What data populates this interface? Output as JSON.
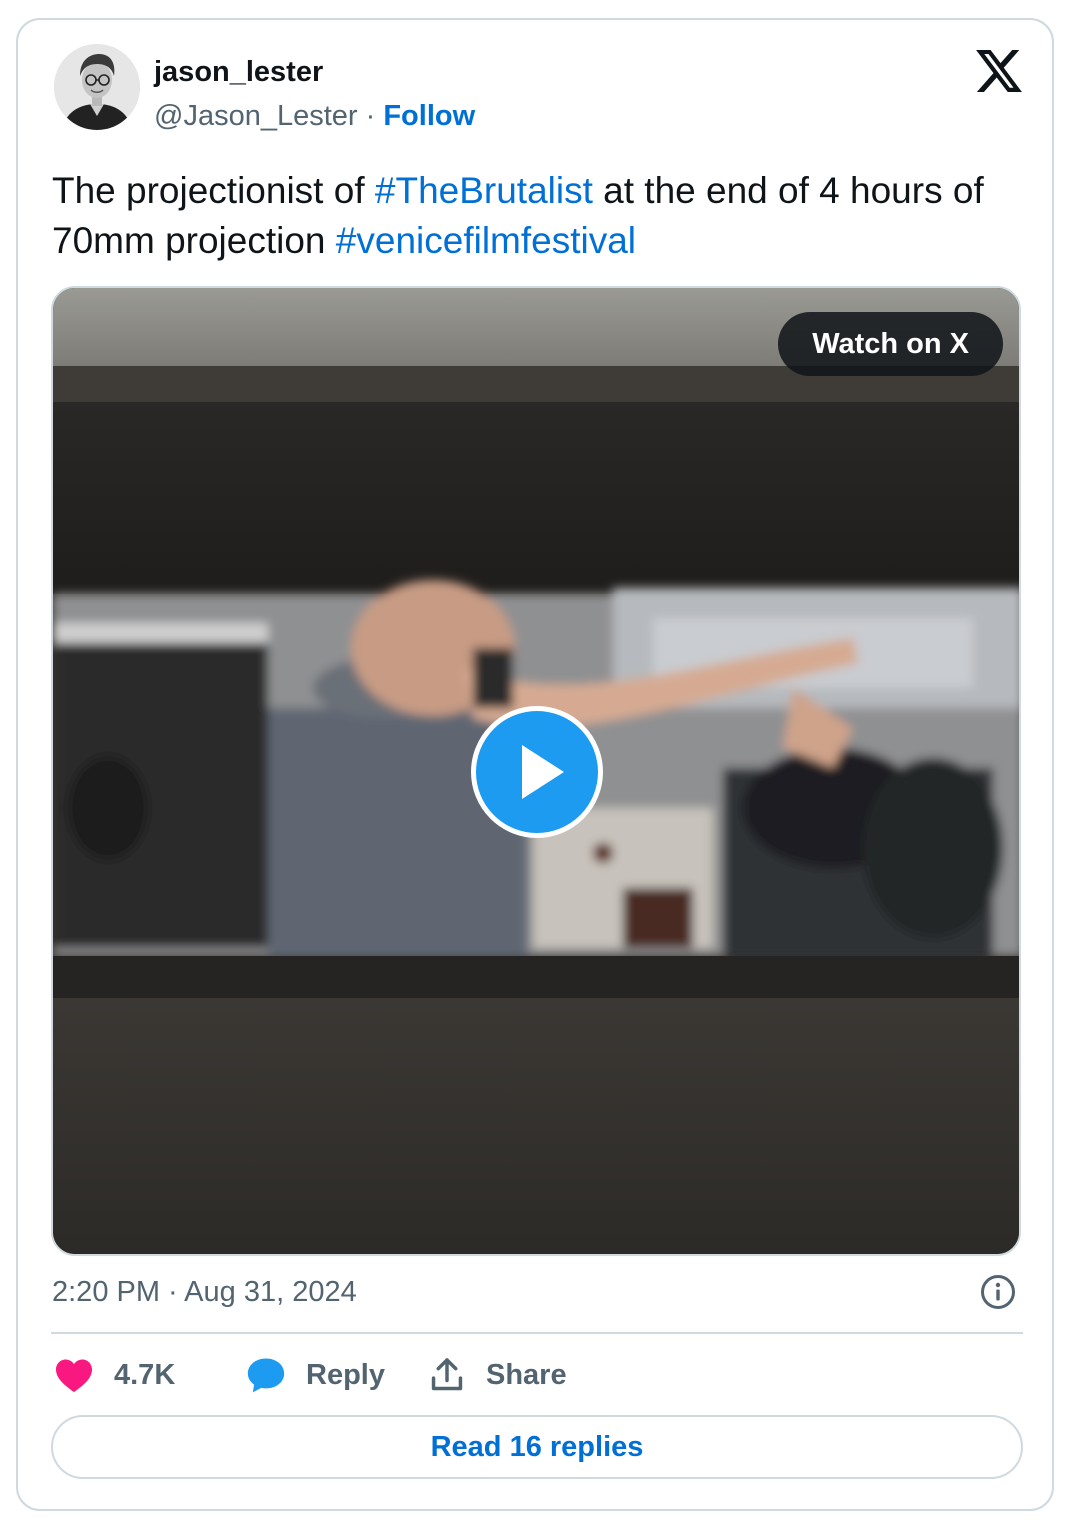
{
  "tweet": {
    "author_name": "jason_lester",
    "handle": "@Jason_Lester",
    "separator": " · ",
    "follow_label": "Follow",
    "text_parts": [
      {
        "text": "The projectionist of ",
        "type": "plain"
      },
      {
        "text": "#TheBrutalist",
        "type": "hashtag"
      },
      {
        "text": " at the end of 4 hours of 70mm projection ",
        "type": "plain"
      },
      {
        "text": "#venicefilmfestival",
        "type": "hashtag"
      }
    ],
    "watch_label": "Watch on X",
    "timestamp": "2:20 PM · Aug 31, 2024",
    "likes_count": "4.7K",
    "reply_label": "Reply",
    "share_label": "Share",
    "read_replies_label": "Read 16 replies"
  },
  "colors": {
    "accent": "#006fd6",
    "play_button": "#1d9bf0",
    "like": "#f91880",
    "reply_icon": "#1d9bf0",
    "muted_text": "#536471",
    "border": "#cfd9de"
  },
  "icons": {
    "brand": "x-logo-icon",
    "info": "info-icon",
    "like": "heart-icon",
    "reply": "speech-bubble-icon",
    "share": "share-upload-icon",
    "play": "play-icon"
  }
}
